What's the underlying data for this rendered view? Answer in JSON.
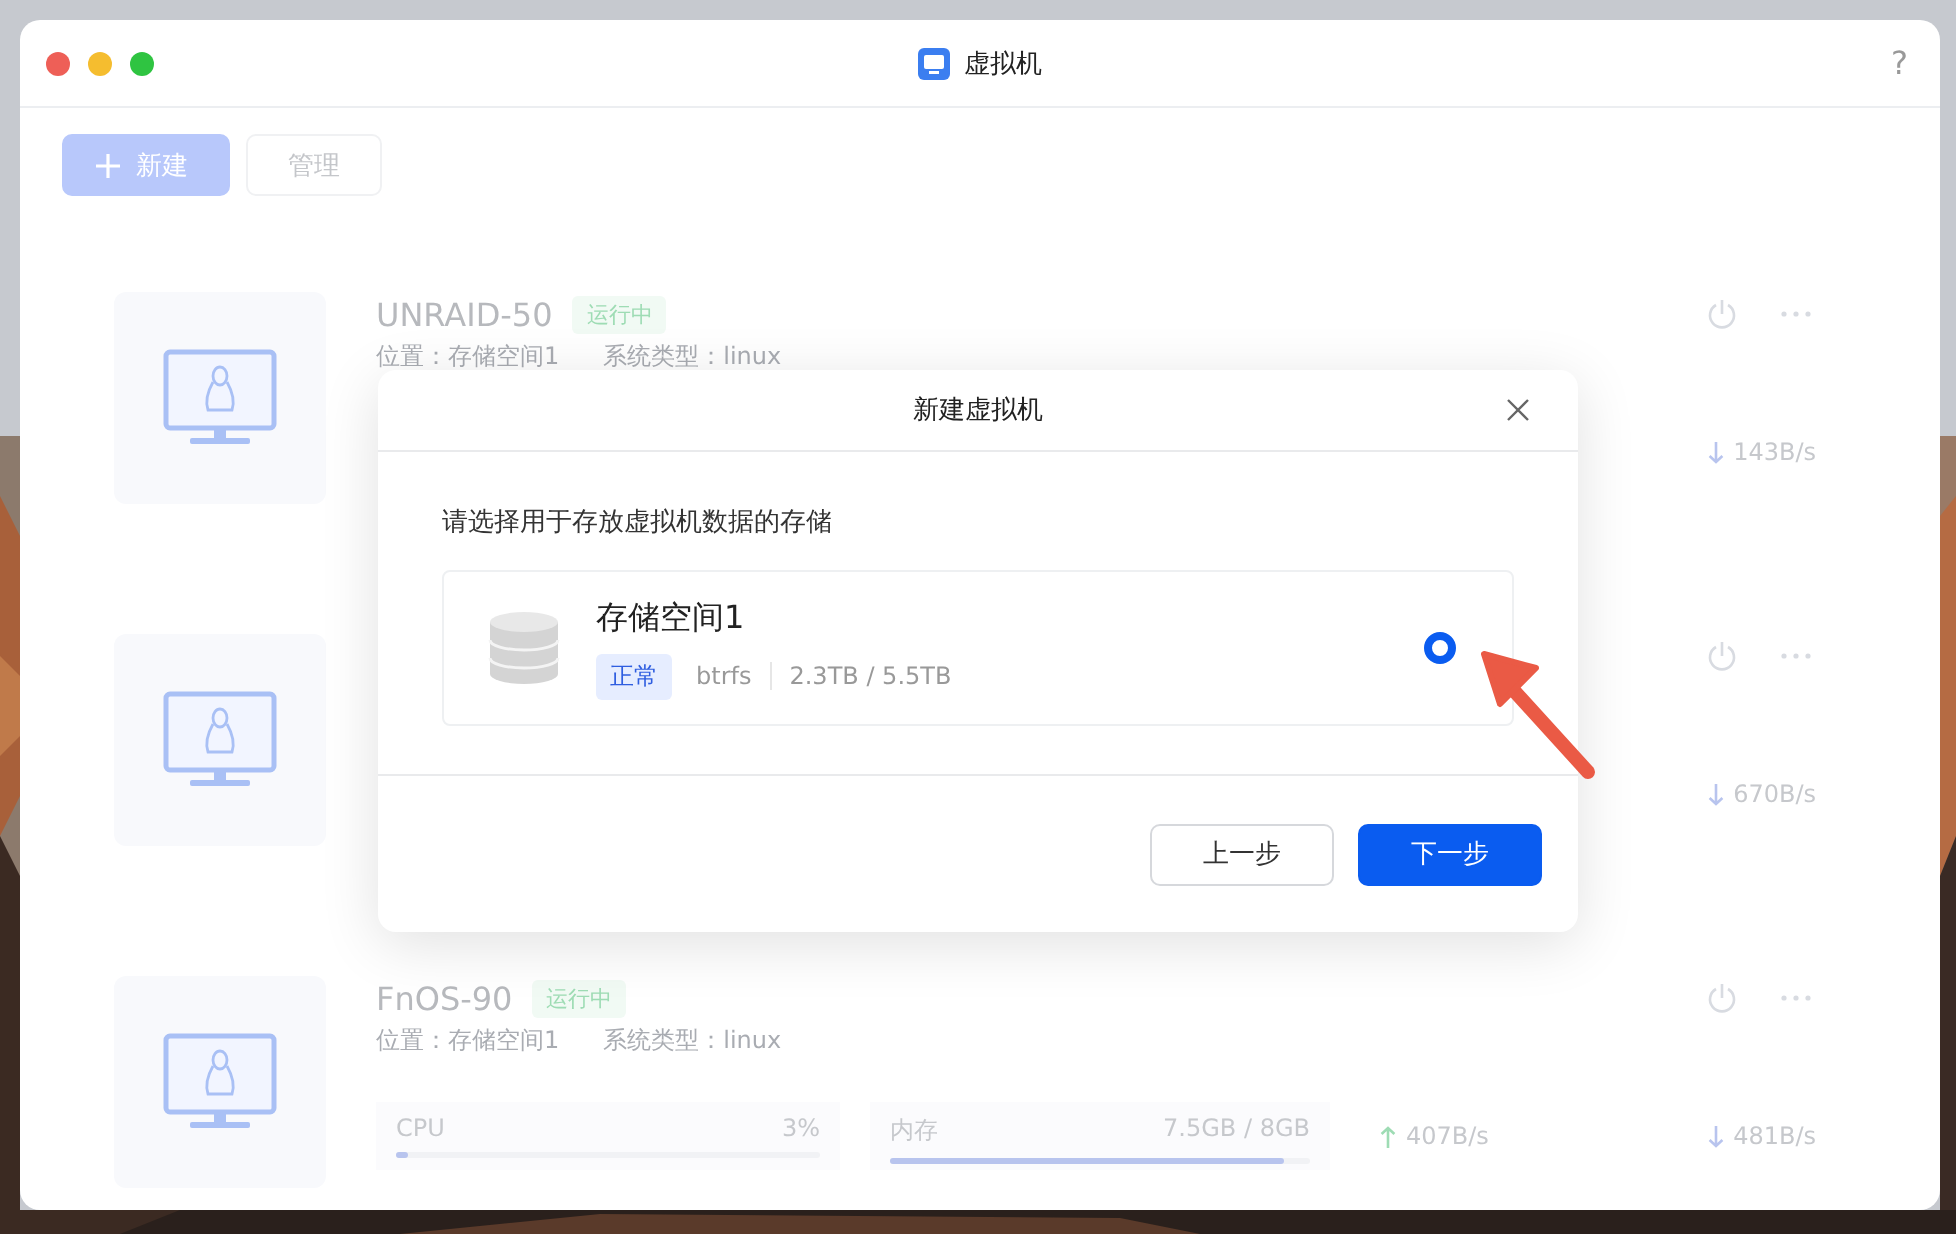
{
  "window": {
    "title": "虚拟机",
    "help": "?"
  },
  "toolbar": {
    "buttons": [
      {
        "label": "新建",
        "kind": "primary"
      },
      {
        "label": "管理",
        "kind": "default"
      }
    ]
  },
  "vms": [
    {
      "name": "UNRAID-50",
      "status": "运行中",
      "location": "位置：存储空间1",
      "os": "系统类型：linux",
      "download": "143B/s"
    },
    {
      "download": "670B/s"
    },
    {
      "name": "FnOS-90",
      "status": "运行中",
      "location": "位置：存储空间1",
      "os": "系统类型：linux",
      "cpu": {
        "label": "CPU",
        "reading": "3%",
        "level": 0.03
      },
      "memory": {
        "label": "内存",
        "reading": "7.5GB / 8GB",
        "level": 0.94
      },
      "upload": "407B/s",
      "download": "481B/s"
    }
  ],
  "dialog": {
    "title": "新建虚拟机",
    "prompt": "请选择用于存放虚拟机数据的存储",
    "storages": [
      {
        "name": "存储空间1",
        "status": "正常",
        "filesystem": "btrfs",
        "usage": "2.3TB / 5.5TB",
        "selected": true
      }
    ],
    "buttons": [
      {
        "label": "上一步",
        "kind": "default"
      },
      {
        "label": "下一步",
        "kind": "primary"
      }
    ]
  }
}
